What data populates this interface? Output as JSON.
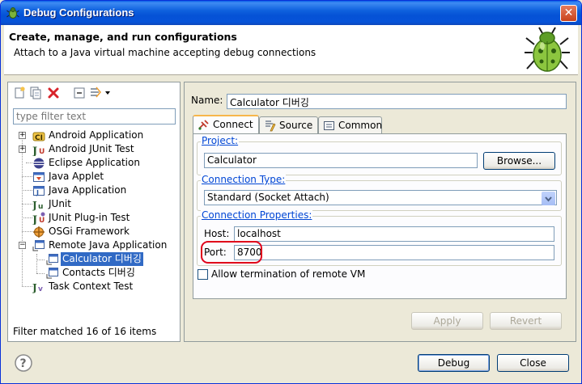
{
  "window": {
    "title": "Debug Configurations",
    "close_glyph": "✕"
  },
  "header": {
    "title": "Create, manage, and run configurations",
    "description": "Attach to a Java virtual machine accepting debug connections"
  },
  "left": {
    "filter_placeholder": "type filter text",
    "tree": [
      {
        "label": "Android Application",
        "icon": "android-app-icon"
      },
      {
        "label": "Android JUnit Test",
        "icon": "android-junit-icon"
      },
      {
        "label": "Eclipse Application",
        "icon": "eclipse-icon"
      },
      {
        "label": "Java Applet",
        "icon": "applet-icon"
      },
      {
        "label": "Java Application",
        "icon": "java-app-icon"
      },
      {
        "label": "JUnit",
        "icon": "junit-icon"
      },
      {
        "label": "JUnit Plug-in Test",
        "icon": "junit-plugin-icon"
      },
      {
        "label": "OSGi Framework",
        "icon": "osgi-icon"
      },
      {
        "label": "Remote Java Application",
        "icon": "remote-java-icon"
      },
      {
        "label": "Calculator 디버깅",
        "icon": "config-icon",
        "selected": true
      },
      {
        "label": "Contacts 디버깅",
        "icon": "config-icon"
      },
      {
        "label": "Task Context Test",
        "icon": "task-context-icon"
      }
    ],
    "filter_status": "Filter matched 16 of 16 items"
  },
  "right": {
    "name_label": "Name:",
    "name_value": "Calculator 디버깅",
    "tabs": [
      {
        "label": "Connect",
        "icon": "connect-icon"
      },
      {
        "label": "Source",
        "icon": "source-icon"
      },
      {
        "label": "Common",
        "icon": "common-icon"
      }
    ],
    "project": {
      "legend": "Project:",
      "value": "Calculator",
      "browse": "Browse..."
    },
    "connection_type": {
      "legend": "Connection Type:",
      "value": "Standard (Socket Attach)"
    },
    "connection_props": {
      "legend": "Connection Properties:",
      "host_label": "Host:",
      "host_value": "localhost",
      "port_label": "Port:",
      "port_value": "8700"
    },
    "allow_termination": "Allow termination of remote VM",
    "apply": "Apply",
    "revert": "Revert"
  },
  "footer": {
    "debug": "Debug",
    "close": "Close"
  }
}
